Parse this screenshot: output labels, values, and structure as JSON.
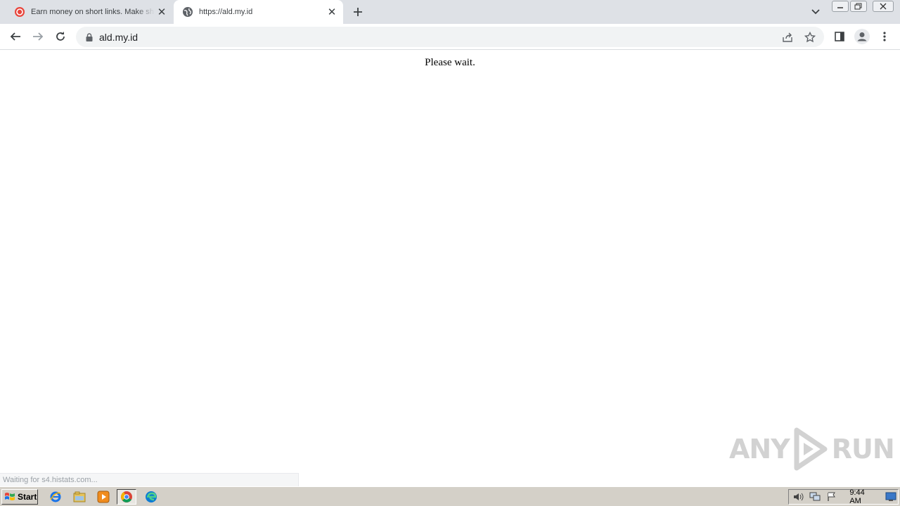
{
  "browser": {
    "tabs": [
      {
        "title": "Earn money on short links. Make short links and earn the biggest money",
        "active": false,
        "favicon": "red-circle-icon"
      },
      {
        "title": "https://ald.my.id",
        "active": true,
        "favicon": "globe-icon"
      }
    ],
    "address": "ald.my.id"
  },
  "page": {
    "message": "Please wait.",
    "status": "Waiting for s4.histats.com..."
  },
  "watermark": {
    "left": "ANY",
    "right": "RUN"
  },
  "taskbar": {
    "start_label": "Start",
    "clock": "9:44 AM"
  },
  "colors": {
    "tabstrip": "#dee1e6",
    "omnibox": "#f1f3f4",
    "taskbar": "#d4d0c8",
    "tab1_favicon": "#e8453c"
  }
}
